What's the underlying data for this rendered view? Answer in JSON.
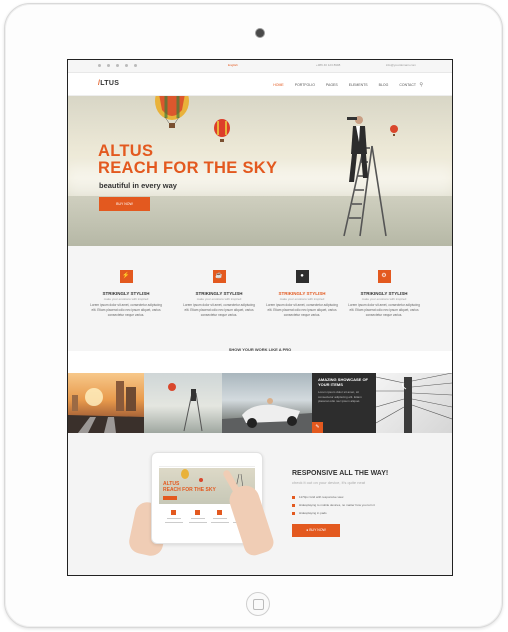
{
  "device": {
    "name": "iPad"
  },
  "topbar": {
    "lang": "English",
    "phone": "+386 40 123 8998",
    "email": "info@yourdomain.com"
  },
  "nav": {
    "logo_mark": "/",
    "logo_text": "LTUS",
    "menu": [
      "HOME",
      "PORTFOLIO",
      "PAGES",
      "ELEMENTS",
      "BLOG",
      "CONTACT"
    ],
    "search_icon": "search-icon"
  },
  "hero": {
    "title_line1": "ALTUS",
    "title_line2": "REACH FOR THE SKY",
    "subtitle": "beautiful in every way",
    "button": "BUY NOW"
  },
  "features": [
    {
      "icon": "lightning-icon",
      "heading": "STRIKINGLY STYLISH",
      "sub": "make your emotions with inspired",
      "text": "Lorem ipsum dolor sit amet, consectetur adipiscing elit. Etiam placerat odio nec ipsum aliquet, varius consectetur neque varius."
    },
    {
      "icon": "coffee-icon",
      "heading": "STRIKINGLY STYLISH",
      "sub": "make your emotions with inspired",
      "text": "Lorem ipsum dolor sit amet, consectetur adipiscing elit. Etiam placerat odio nec ipsum aliquet, varius consectetur neque varius."
    },
    {
      "icon": "user-icon",
      "heading": "STRIKINGLY STYLISH",
      "sub": "make your emotions with inspired",
      "text": "Lorem ipsum dolor sit amet, consectetur adipiscing elit. Etiam placerat odio nec ipsum aliquet, varius consectetur neque varius."
    },
    {
      "icon": "gear-icon",
      "heading": "STRIKINGLY STYLISH",
      "sub": "make your emotions with inspired",
      "text": "Lorem ipsum dolor sit amet, consectetur adipiscing elit. Etiam placerat odio nec ipsum aliquet, varius consectetur neque varius."
    }
  ],
  "showcase": {
    "heading": "SHOW YOUR WORK LIKE A PRO",
    "card_title": "AMAZING SHOWCASE OF YOUR ITEMS",
    "card_text": "Lorem ipsum dolor sit amet, sit consectetur adipiscing elit. Etiam placerat odio nec ipsum aliquet."
  },
  "responsive": {
    "title": "RESPONSIVE ALL THE WAY!",
    "subtitle": "check it out on your device, it's quite neat",
    "items": [
      "1170px Grid with responsive view",
      "Hidesplaying to mobile devices, no matter how you turn it",
      "Hidesplaying in pads"
    ],
    "button": "BUY NOW"
  },
  "colors": {
    "accent": "#e3591f",
    "dark": "#2e2e2e"
  }
}
